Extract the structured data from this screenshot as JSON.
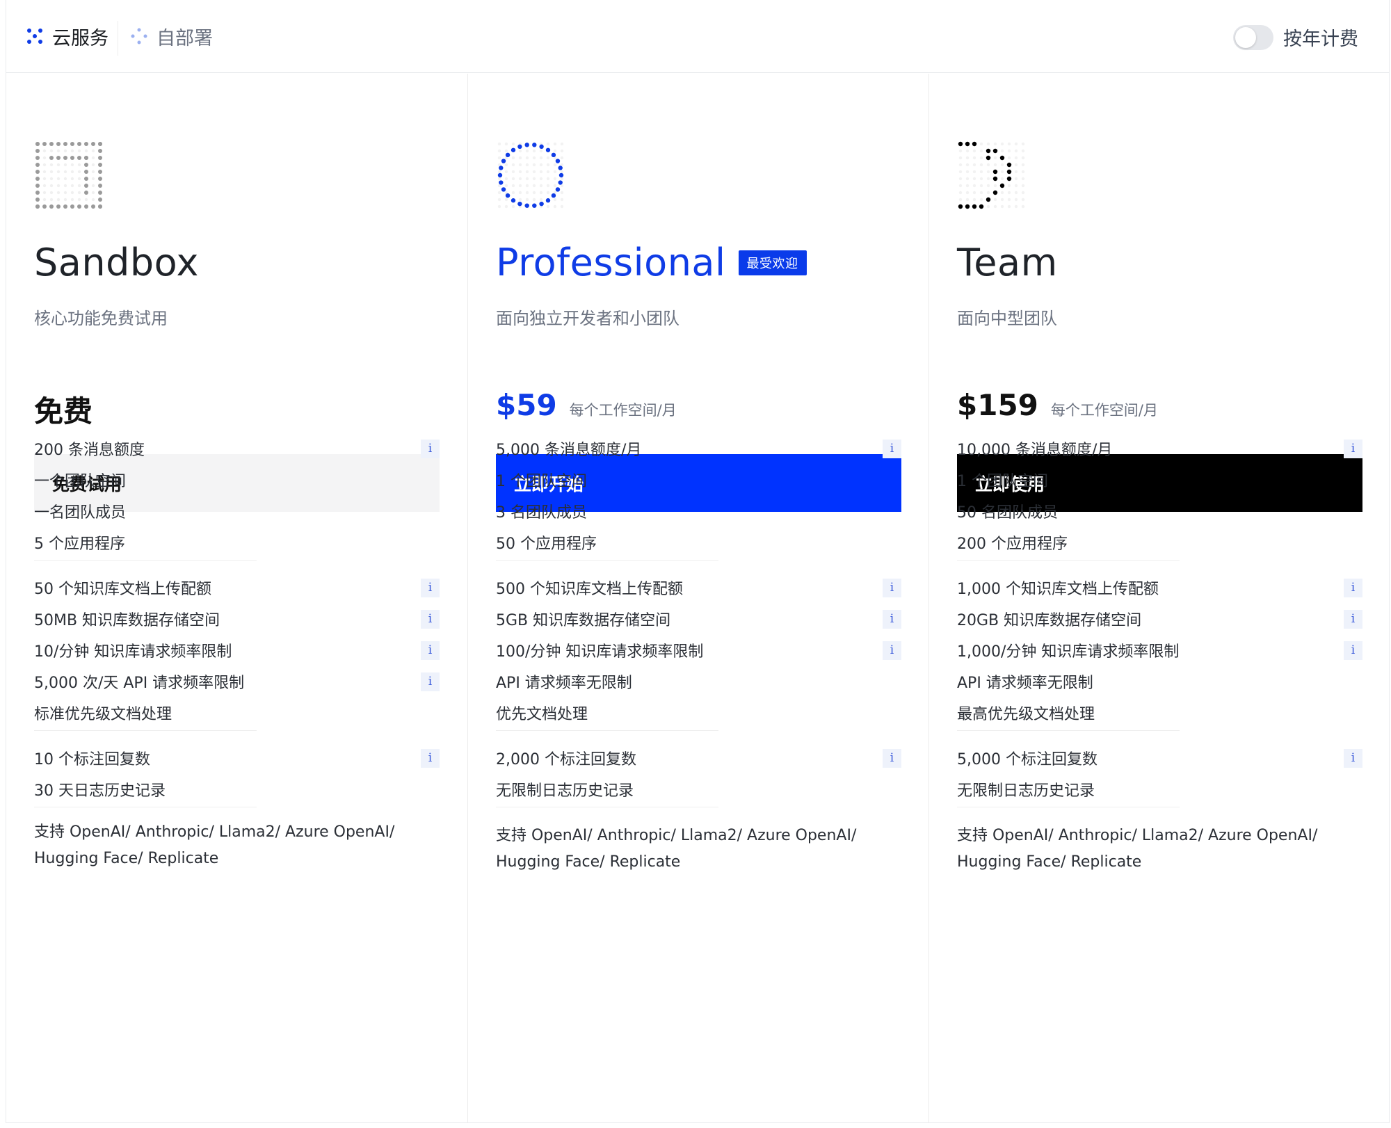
{
  "tabs": {
    "cloud": "云服务",
    "self_hosted": "自部署"
  },
  "billing_toggle": {
    "label": "按年计费"
  },
  "colors": {
    "accent_blue": "#0033ff",
    "black": "#000000",
    "muted_gray": "#6b7280"
  },
  "plans": [
    {
      "name": "Sandbox",
      "description": "核心功能免费试用",
      "price": "免费",
      "price_unit": "",
      "cta": "免费试用",
      "icon": "square-dots-icon",
      "features": [
        {
          "text": "200 条消息额度",
          "info": true
        },
        {
          "text": "一个团队空间",
          "info": false
        },
        {
          "text": "一名团队成员",
          "info": false
        },
        {
          "text": "5 个应用程序",
          "info": false
        },
        {
          "text": "50 个知识库文档上传配额",
          "info": true
        },
        {
          "text": "50MB 知识库数据存储空间",
          "info": true
        },
        {
          "text": "10/分钟 知识库请求频率限制",
          "info": true
        },
        {
          "text": "5,000 次/天 API 请求频率限制",
          "info": true
        },
        {
          "text": "标准优先级文档处理",
          "info": false
        },
        {
          "text": "10 个标注回复数",
          "info": true
        },
        {
          "text": "30 天日志历史记录",
          "info": false
        }
      ],
      "support_line1": "支持 OpenAI/ Anthropic/ Llama2/ Azure OpenAI/",
      "support_line2": "Hugging Face/ Replicate"
    },
    {
      "name": "Professional",
      "badge": "最受欢迎",
      "description": "面向独立开发者和小团队",
      "price": "$59",
      "price_unit": "每个工作空间/月",
      "cta": "立即开始",
      "icon": "circle-dots-icon",
      "features": [
        {
          "text": "5,000 条消息额度/月",
          "info": true
        },
        {
          "text": "1 个团队空间",
          "info": false
        },
        {
          "text": "3 名团队成员",
          "info": false
        },
        {
          "text": "50 个应用程序",
          "info": false
        },
        {
          "text": "500 个知识库文档上传配额",
          "info": true
        },
        {
          "text": "5GB 知识库数据存储空间",
          "info": true
        },
        {
          "text": "100/分钟 知识库请求频率限制",
          "info": true
        },
        {
          "text": "API 请求频率无限制",
          "info": false
        },
        {
          "text": "优先文档处理",
          "info": false
        },
        {
          "text": "2,000 个标注回复数",
          "info": true
        },
        {
          "text": "无限制日志历史记录",
          "info": false
        }
      ],
      "support_line1": "支持 OpenAI/ Anthropic/ Llama2/ Azure OpenAI/",
      "support_line2": "Hugging Face/ Replicate"
    },
    {
      "name": "Team",
      "description": "面向中型团队",
      "price": "$159",
      "price_unit": "每个工作空间/月",
      "cta": "立即使用",
      "icon": "d-shape-dots-icon",
      "features": [
        {
          "text": "10,000 条消息额度/月",
          "info": true
        },
        {
          "text": "1 个团队空间",
          "info": false
        },
        {
          "text": "50 名团队成员",
          "info": false
        },
        {
          "text": "200 个应用程序",
          "info": false
        },
        {
          "text": "1,000 个知识库文档上传配额",
          "info": true
        },
        {
          "text": "20GB 知识库数据存储空间",
          "info": true
        },
        {
          "text": "1,000/分钟 知识库请求频率限制",
          "info": true
        },
        {
          "text": "API 请求频率无限制",
          "info": false
        },
        {
          "text": "最高优先级文档处理",
          "info": false
        },
        {
          "text": "5,000 个标注回复数",
          "info": true
        },
        {
          "text": "无限制日志历史记录",
          "info": false
        }
      ],
      "support_line1": "支持 OpenAI/ Anthropic/ Llama2/ Azure OpenAI/",
      "support_line2": "Hugging Face/ Replicate"
    }
  ]
}
